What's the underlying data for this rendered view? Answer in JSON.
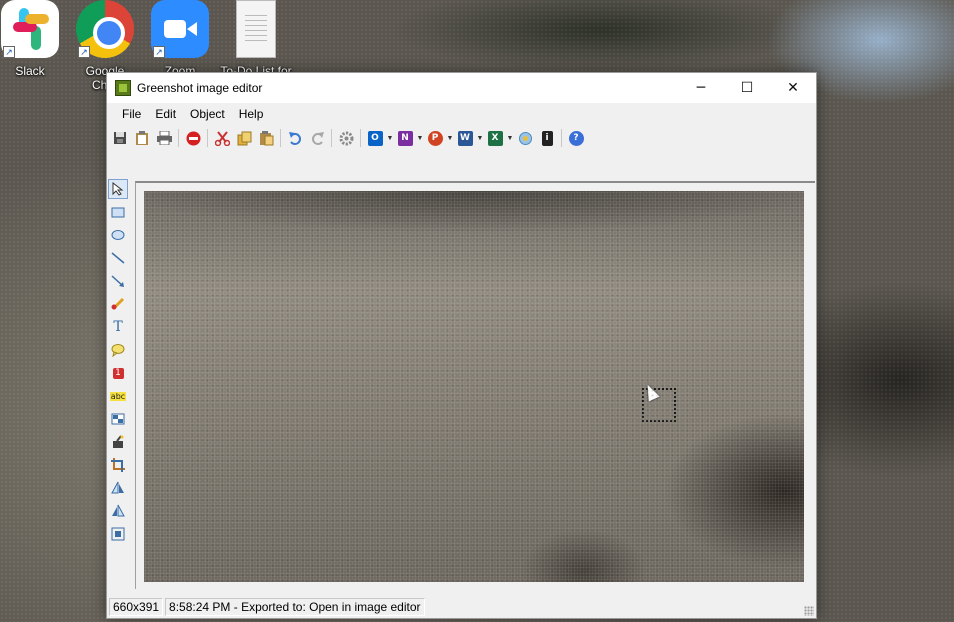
{
  "desktop": {
    "icons": [
      {
        "label": "Slack"
      },
      {
        "label": "Google Chrome",
        "label_line1": "Google",
        "label_line2": "Chro"
      },
      {
        "label": "Zoom"
      },
      {
        "label": "To-Do List for"
      }
    ]
  },
  "window": {
    "title": "Greenshot image editor",
    "controls": {
      "minimize": "─",
      "maximize": "☐",
      "close": "✕"
    }
  },
  "menu": {
    "items": [
      "File",
      "Edit",
      "Object",
      "Help"
    ]
  },
  "toolbar": {
    "buttons": [
      "save",
      "clipboard",
      "print",
      "close",
      "cut",
      "copy",
      "paste",
      "undo",
      "redo",
      "settings",
      "outlook",
      "onenote",
      "powerpoint",
      "word",
      "excel",
      "imgur",
      "info",
      "help"
    ],
    "outlook_letter": "O",
    "onenote_letter": "N",
    "powerpoint_letter": "P",
    "word_letter": "W",
    "excel_letter": "X",
    "info_letter": "i",
    "help_letter": "?"
  },
  "tools": [
    "select",
    "rectangle",
    "ellipse",
    "line",
    "arrow",
    "freehand",
    "text",
    "speechbubble",
    "counter",
    "highlight",
    "obfuscate",
    "effects",
    "crop",
    "rotate-clockwise",
    "rotate-counterclockwise",
    "resize"
  ],
  "tool_glyphs": {
    "text": "T",
    "counter": "1",
    "highlight": "abc"
  },
  "status": {
    "dimensions": "660x391",
    "message": "8:58:24 PM - Exported to: Open in image editor"
  },
  "colors": {
    "accent": "#3a6ea5",
    "outlook": "#0a64c8",
    "onenote": "#7b2ea0",
    "powerpoint": "#d04423",
    "word": "#2b5797",
    "excel": "#1e7145"
  }
}
